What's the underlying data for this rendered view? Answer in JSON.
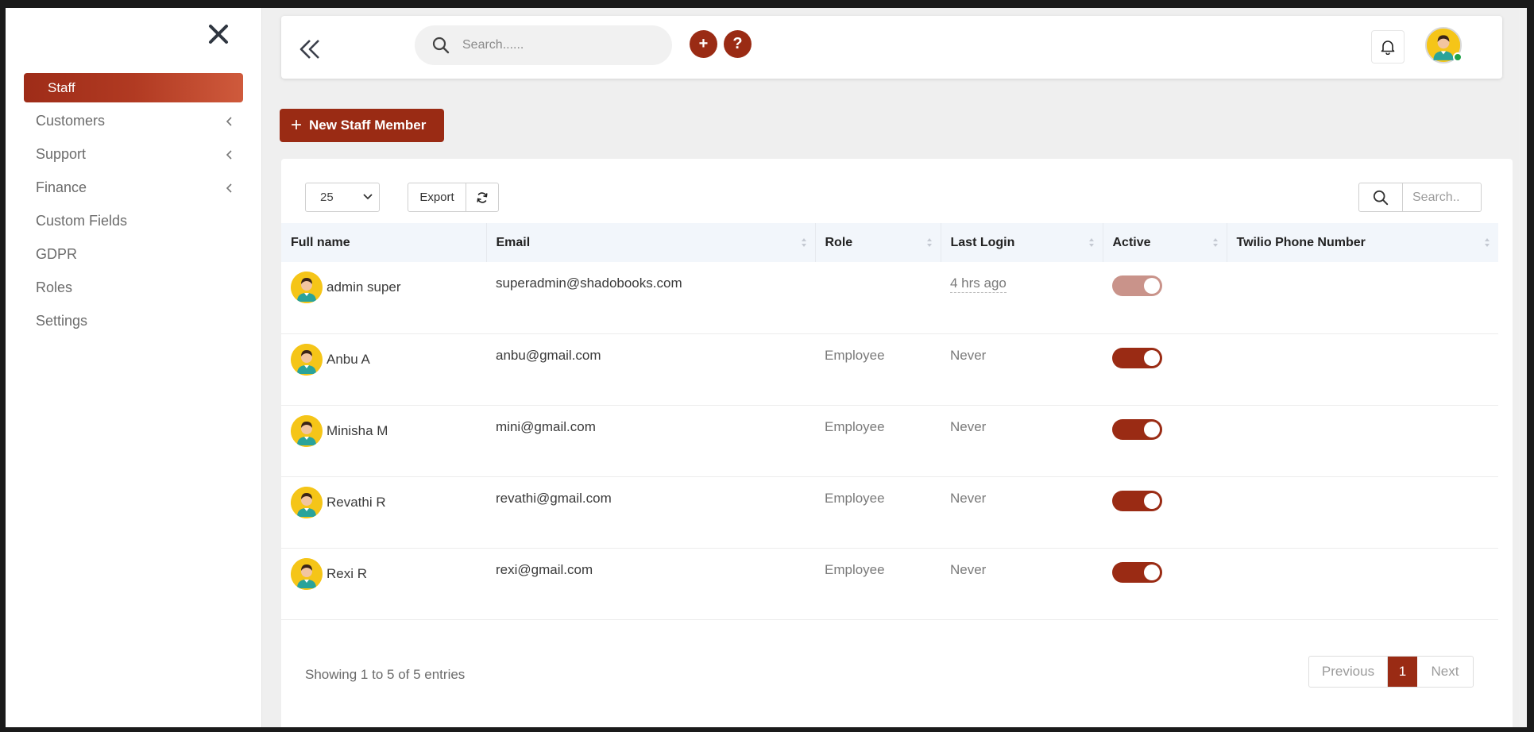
{
  "colors": {
    "accent": "#9a2b14",
    "accent_light": "#cf5a3c",
    "online": "#20a34a"
  },
  "sidebar": {
    "items": [
      {
        "label": "Staff",
        "active": true,
        "has_submenu": false
      },
      {
        "label": "Customers",
        "active": false,
        "has_submenu": true
      },
      {
        "label": "Support",
        "active": false,
        "has_submenu": true
      },
      {
        "label": "Finance",
        "active": false,
        "has_submenu": true
      },
      {
        "label": "Custom Fields",
        "active": false,
        "has_submenu": false
      },
      {
        "label": "GDPR",
        "active": false,
        "has_submenu": false
      },
      {
        "label": "Roles",
        "active": false,
        "has_submenu": false
      },
      {
        "label": "Settings",
        "active": false,
        "has_submenu": false
      }
    ]
  },
  "header": {
    "search_placeholder": "Search......",
    "add_label": "+",
    "help_label": "?"
  },
  "toolbar": {
    "new_staff_label": "New Staff Member",
    "page_size": "25",
    "export_label": "Export",
    "search_placeholder": "Search.."
  },
  "table": {
    "columns": [
      "Full name",
      "Email",
      "Role",
      "Last Login",
      "Active",
      "Twilio Phone Number"
    ],
    "rows": [
      {
        "name": "admin super",
        "email": "superadmin@shadobooks.com",
        "role": "",
        "last_login": "4 hrs ago",
        "active": true,
        "twilio": ""
      },
      {
        "name": "Anbu A",
        "email": "anbu@gmail.com",
        "role": "Employee",
        "last_login": "Never",
        "active": true,
        "twilio": ""
      },
      {
        "name": "Minisha M",
        "email": "mini@gmail.com",
        "role": "Employee",
        "last_login": "Never",
        "active": true,
        "twilio": ""
      },
      {
        "name": "Revathi R",
        "email": "revathi@gmail.com",
        "role": "Employee",
        "last_login": "Never",
        "active": true,
        "twilio": ""
      },
      {
        "name": "Rexi R",
        "email": "rexi@gmail.com",
        "role": "Employee",
        "last_login": "Never",
        "active": true,
        "twilio": ""
      }
    ]
  },
  "footer": {
    "info": "Showing 1 to 5 of 5 entries",
    "prev_label": "Previous",
    "current_page": "1",
    "next_label": "Next"
  }
}
